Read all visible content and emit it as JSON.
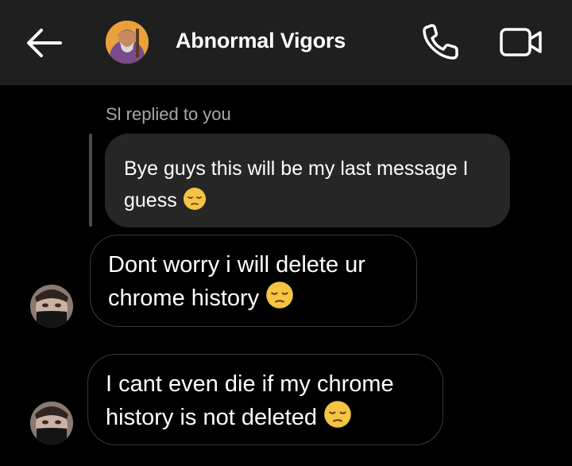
{
  "header": {
    "title": "Abnormal Vigors",
    "background": "#1f1f1f"
  },
  "reply": {
    "note": "Sl replied to you",
    "quoted_text": "Bye guys this will be my last message I guess",
    "quoted_emoji": "pensive-face"
  },
  "messages": [
    {
      "text": "Dont worry i will delete ur chrome history",
      "emoji": "pensive-face"
    },
    {
      "text": "I cant even die if my chrome history is not deleted",
      "emoji": "pensive-face"
    }
  ],
  "icons": {
    "back": "arrow-left-icon",
    "call": "phone-icon",
    "video": "video-camera-icon"
  },
  "colors": {
    "background": "#000000",
    "bubble_quoted": "#262626",
    "bubble_border": "#3a3a3a",
    "muted_text": "#a8a8a8",
    "emoji_yellow": "#f4c542"
  }
}
